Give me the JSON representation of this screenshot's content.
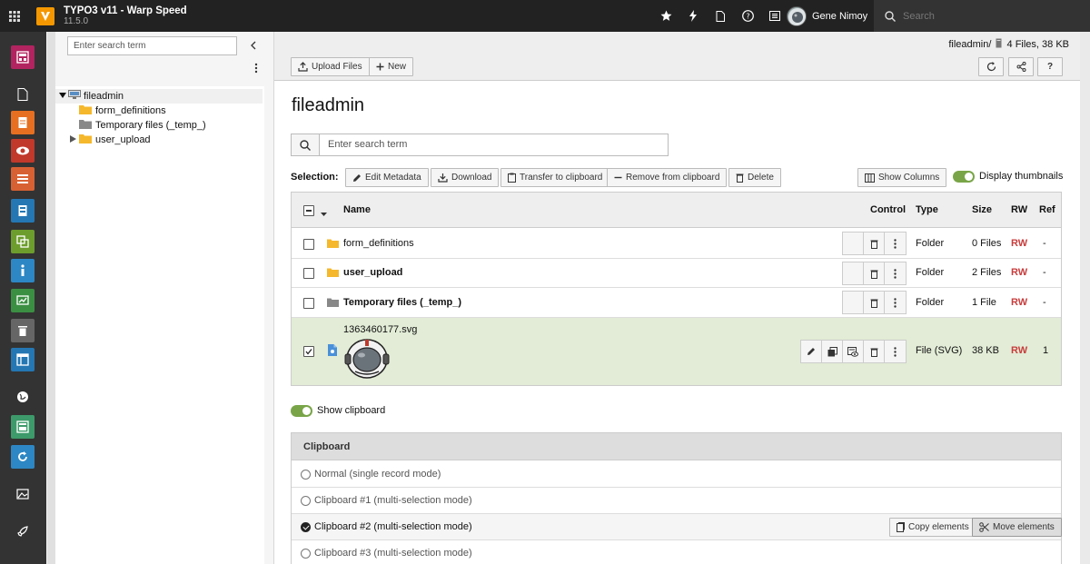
{
  "topbar": {
    "title": "TYPO3 v11 - Warp Speed",
    "version": "11.5.0",
    "user_name": "Gene Nimoy",
    "search_placeholder": "Search",
    "icons": [
      "star-icon",
      "bolt-icon",
      "file-icon",
      "help-icon",
      "list-icon"
    ]
  },
  "modules": [
    {
      "name": "dashboard",
      "color": "#b1245f"
    },
    {
      "name": "page",
      "color": ""
    },
    {
      "name": "view",
      "color": "#e66f21"
    },
    {
      "name": "list",
      "color": "#c0392b"
    },
    {
      "name": "list-view",
      "color": "#d86133"
    },
    {
      "name": "form",
      "color": "#2577b3"
    },
    {
      "name": "workspaces",
      "color": "#6d9d2c"
    },
    {
      "name": "info",
      "color": "#2d87c4"
    },
    {
      "name": "reports",
      "color": "#3b8f43"
    },
    {
      "name": "recycler",
      "color": "#666666"
    },
    {
      "name": "template",
      "color": "#2577b3"
    },
    {
      "name": "sites",
      "color": ""
    },
    {
      "name": "filelist",
      "color": "#3d9a6a"
    },
    {
      "name": "sync",
      "color": "#2d87c4"
    },
    {
      "name": "media",
      "color": ""
    },
    {
      "name": "rocket",
      "color": ""
    }
  ],
  "tree": {
    "search_placeholder": "Enter search term",
    "root": "fileadmin",
    "children": [
      {
        "label": "form_definitions",
        "type": "folder"
      },
      {
        "label": "Temporary files (_temp_)",
        "type": "folder-gray"
      },
      {
        "label": "user_upload",
        "type": "folder",
        "expandable": true
      }
    ]
  },
  "docheader": {
    "path_folder": "fileadmin/",
    "path_info": "4 Files, 38 KB",
    "upload_label": "Upload Files",
    "new_label": "New"
  },
  "main": {
    "title": "fileadmin",
    "search_placeholder": "Enter search term",
    "selection_label": "Selection:",
    "actions": {
      "edit_metadata": "Edit Metadata",
      "download": "Download",
      "transfer": "Transfer to clipboard",
      "remove": "Remove from clipboard",
      "delete": "Delete"
    },
    "show_columns": "Show Columns",
    "display_thumbnails": "Display thumbnails",
    "show_clipboard": "Show clipboard"
  },
  "table": {
    "headers": {
      "name": "Name",
      "control": "Control",
      "type": "Type",
      "size": "Size",
      "rw": "RW",
      "ref": "Ref"
    },
    "rows": [
      {
        "name": "form_definitions",
        "bold": false,
        "type": "Folder",
        "size": "0 Files",
        "rw": "RW",
        "ref": "-",
        "checked": false
      },
      {
        "name": "user_upload",
        "bold": true,
        "type": "Folder",
        "size": "2 Files",
        "rw": "RW",
        "ref": "-",
        "checked": false
      },
      {
        "name": "Temporary files (_temp_)",
        "bold": true,
        "type": "Folder",
        "size": "1 File",
        "rw": "RW",
        "ref": "-",
        "checked": false
      },
      {
        "name": "1363460177.svg",
        "bold": false,
        "type": "File (SVG)",
        "size": "38 KB",
        "rw": "RW",
        "ref": "1",
        "checked": true
      }
    ]
  },
  "clipboard": {
    "title": "Clipboard",
    "modes": [
      {
        "label": "Normal (single record mode)",
        "active": false
      },
      {
        "label": "Clipboard #1 (multi-selection mode)",
        "active": false
      },
      {
        "label": "Clipboard #2 (multi-selection mode)",
        "active": true
      },
      {
        "label": "Clipboard #3 (multi-selection mode)",
        "active": false
      }
    ],
    "copy_label": "Copy elements",
    "move_label": "Move elements"
  }
}
